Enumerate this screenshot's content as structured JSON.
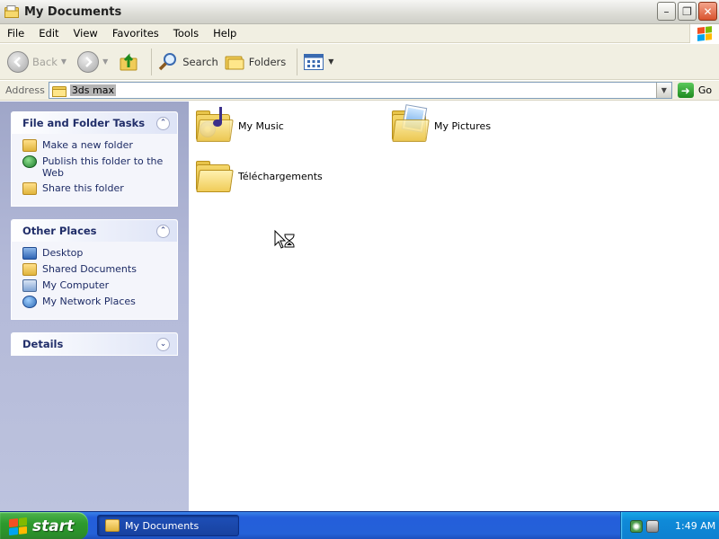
{
  "window": {
    "title": "My Documents",
    "buttons": {
      "minimize": "–",
      "maximize": "❐",
      "close": "✕"
    }
  },
  "menu": {
    "items": [
      "File",
      "Edit",
      "View",
      "Favorites",
      "Tools",
      "Help"
    ]
  },
  "toolbar": {
    "back_label": "Back",
    "search_label": "Search",
    "folders_label": "Folders"
  },
  "address": {
    "label": "Address",
    "value": "3ds max",
    "go_label": "Go"
  },
  "taskpane": {
    "file_tasks": {
      "title": "File and Folder Tasks",
      "items": [
        {
          "label": "Make a new folder",
          "icon": "new-folder-icon"
        },
        {
          "label": "Publish this folder to the Web",
          "icon": "publish-web-icon"
        },
        {
          "label": "Share this folder",
          "icon": "share-folder-icon"
        }
      ]
    },
    "other_places": {
      "title": "Other Places",
      "items": [
        {
          "label": "Desktop",
          "icon": "desktop-icon"
        },
        {
          "label": "Shared Documents",
          "icon": "folder-icon"
        },
        {
          "label": "My Computer",
          "icon": "computer-icon"
        },
        {
          "label": "My Network Places",
          "icon": "network-icon"
        }
      ]
    },
    "details": {
      "title": "Details"
    }
  },
  "content": {
    "items": [
      {
        "label": "My Music",
        "icon": "music-folder-icon"
      },
      {
        "label": "My Pictures",
        "icon": "pictures-folder-icon"
      },
      {
        "label": "Téléchargements",
        "icon": "folder-icon"
      }
    ]
  },
  "taskbar": {
    "start_label": "start",
    "active_task": "My Documents",
    "clock": "1:49 AM"
  },
  "colors": {
    "taskbar_blue": "#245edb",
    "start_green": "#2d9a2d",
    "taskpane_bg": "#b3b9d8",
    "panel_title": "#212e69"
  }
}
